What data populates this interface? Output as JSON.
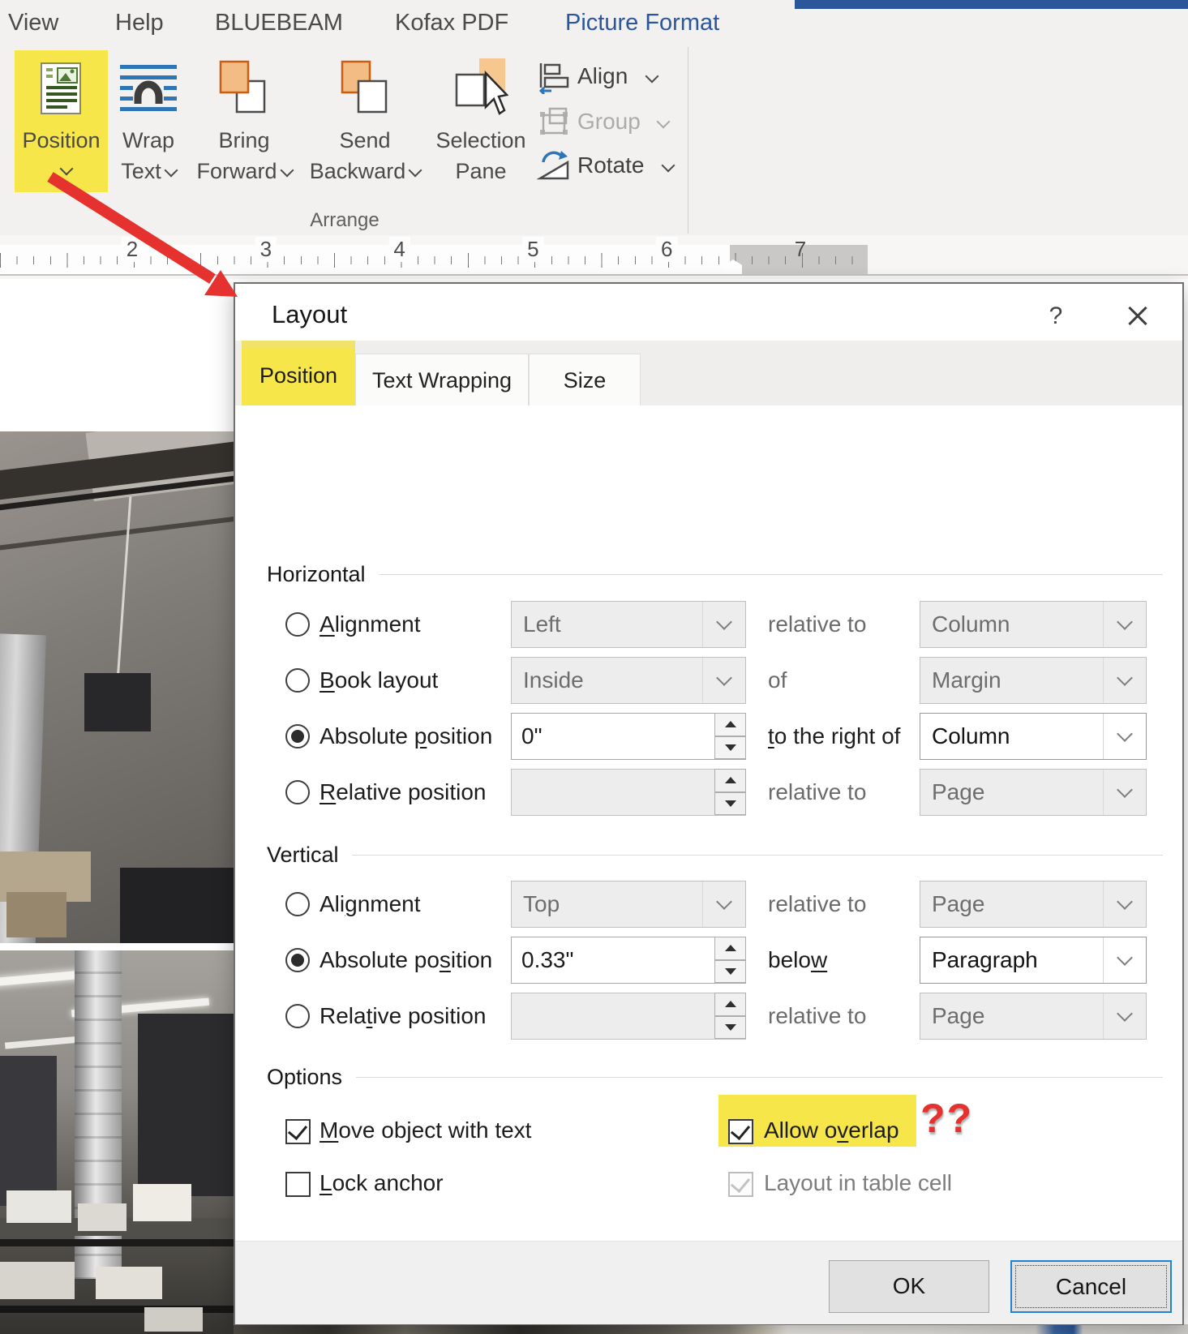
{
  "colors": {
    "highlight_yellow": "#f6e649",
    "arrow_red": "#e5322f",
    "accent_blue": "#2b579a",
    "focus_button_blue": "#1f82d2"
  },
  "ribbon": {
    "tabs": [
      {
        "label": "View"
      },
      {
        "label": "Help"
      },
      {
        "label": "BLUEBEAM"
      },
      {
        "label": "Kofax PDF"
      },
      {
        "label": "Picture Format",
        "active": true
      }
    ],
    "position_button": {
      "label": "Position"
    },
    "wrap_text_button": {
      "line1": "Wrap",
      "line2": "Text"
    },
    "bring_forward_button": {
      "line1": "Bring",
      "line2": "Forward"
    },
    "send_backward_button": {
      "line1": "Send",
      "line2": "Backward"
    },
    "selection_pane_button": {
      "line1": "Selection",
      "line2": "Pane"
    },
    "align_button": {
      "label": "Align"
    },
    "group_button": {
      "label": "Group"
    },
    "rotate_button": {
      "label": "Rotate"
    },
    "group_label": "Arrange"
  },
  "ruler": {
    "numbers": [
      "2",
      "3",
      "4",
      "5",
      "6",
      "7"
    ]
  },
  "dialog": {
    "title": "Layout",
    "help_label": "?",
    "tabs": [
      {
        "label": "Position",
        "active": true
      },
      {
        "label": "Text Wrapping"
      },
      {
        "label": "Size"
      }
    ],
    "sections": {
      "horizontal": {
        "label": "Horizontal",
        "rows": [
          {
            "label": {
              "pre": "",
              "key": "A",
              "post": "lignment"
            },
            "value": "Left",
            "mid": {
              "pre": "relative to",
              "key": "",
              "post": ""
            },
            "right": "Column"
          },
          {
            "label": {
              "pre": "",
              "key": "B",
              "post": "ook layout"
            },
            "value": "Inside",
            "mid": {
              "pre": "of",
              "key": "",
              "post": ""
            },
            "right": "Margin"
          },
          {
            "label": {
              "pre": "Absolute ",
              "key": "p",
              "post": "osition"
            },
            "value": "0\"",
            "mid": {
              "pre": "",
              "key": "t",
              "post": "o the right of"
            },
            "right": "Column"
          },
          {
            "label": {
              "pre": "",
              "key": "R",
              "post": "elative position"
            },
            "value": "",
            "mid": {
              "pre": "relative to",
              "key": "",
              "post": ""
            },
            "right": "Page"
          }
        ]
      },
      "vertical": {
        "label": "Vertical",
        "rows": [
          {
            "label": {
              "pre": "Ali",
              "key": "g",
              "post": "nment"
            },
            "value": "Top",
            "mid": {
              "pre": "relative to",
              "key": "",
              "post": ""
            },
            "right": "Page"
          },
          {
            "label": {
              "pre": "Absolute po",
              "key": "s",
              "post": "ition"
            },
            "value": "0.33\"",
            "mid": {
              "pre": "belo",
              "key": "w",
              "post": ""
            },
            "right": "Paragraph"
          },
          {
            "label": {
              "pre": "Rela",
              "key": "t",
              "post": "ive position"
            },
            "value": "",
            "mid": {
              "pre": "relative to",
              "key": "",
              "post": ""
            },
            "right": "Page"
          }
        ]
      },
      "options": {
        "label": "Options",
        "left": [
          {
            "label": {
              "pre": "",
              "key": "M",
              "post": "ove object with text"
            }
          },
          {
            "label": {
              "pre": "",
              "key": "L",
              "post": "ock anchor"
            }
          }
        ],
        "right": [
          {
            "label": {
              "pre": "Allow o",
              "key": "v",
              "post": "erlap"
            }
          },
          {
            "label": {
              "pre": "Layout in table cell",
              "key": "",
              "post": ""
            }
          }
        ]
      }
    },
    "footer": {
      "ok": "OK",
      "cancel": "Cancel"
    }
  },
  "annotation": {
    "question_marks": "??"
  }
}
